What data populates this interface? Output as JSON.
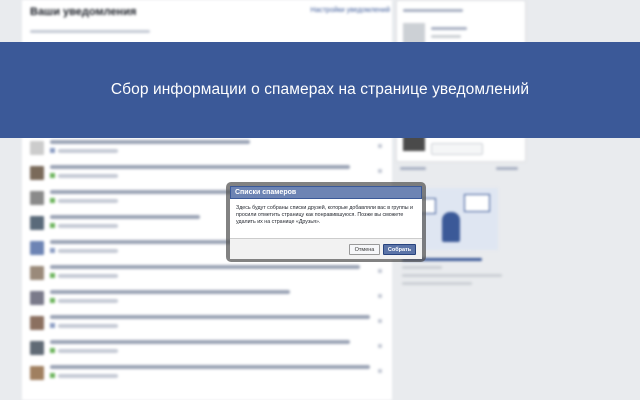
{
  "page": {
    "title": "Ваши уведомления",
    "settings_link": "Настройки уведомлений"
  },
  "banner": {
    "text": "Сбор информации о спамерах на странице уведомлений"
  },
  "dialog": {
    "title": "Списки спамеров",
    "body": "Здесь будут собраны списки друзей, которые добавляли вас в группы и просили отметить страницу как понравившуюся. Позже вы сможете удалить их на странице «Друзья».",
    "cancel_label": "Отмена",
    "collect_label": "Собрать"
  },
  "colors": {
    "banner": "#3b5998",
    "dialog_title": "#6d84b4",
    "primary_button": "#5b74a8"
  }
}
